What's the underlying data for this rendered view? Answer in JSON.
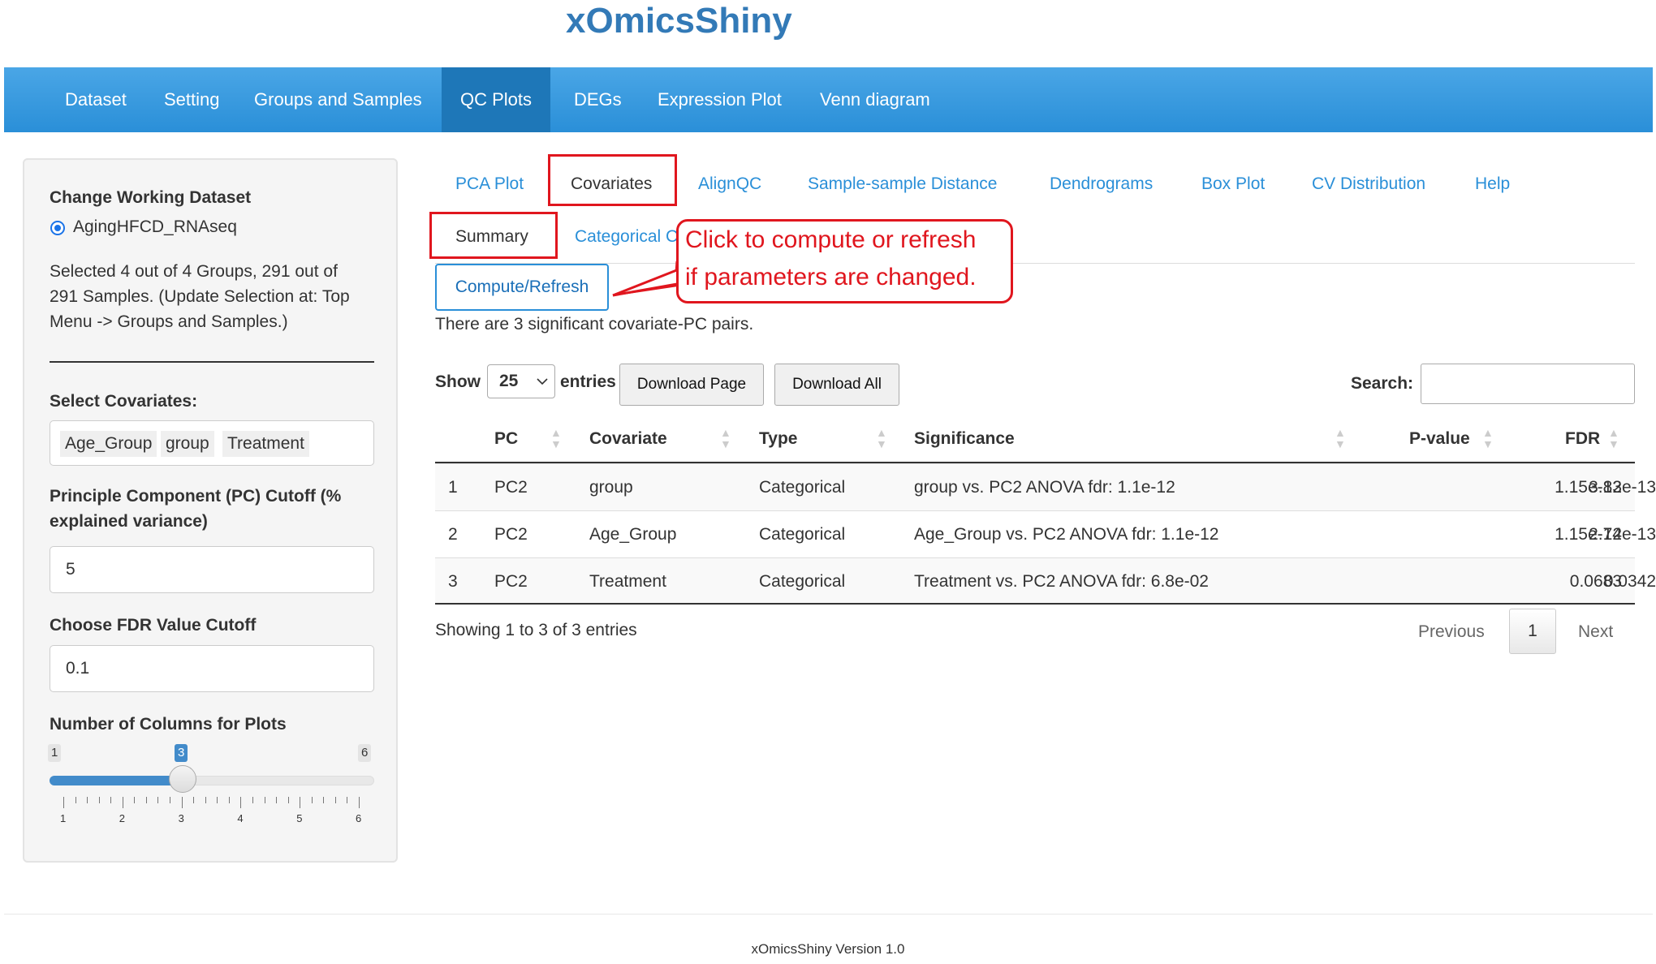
{
  "app": {
    "title": "xOmicsShiny"
  },
  "navbar": {
    "items": [
      {
        "label": "Dataset"
      },
      {
        "label": "Setting"
      },
      {
        "label": "Groups and Samples"
      },
      {
        "label": "QC Plots",
        "active": true
      },
      {
        "label": "DEGs"
      },
      {
        "label": "Expression Plot"
      },
      {
        "label": "Venn diagram"
      }
    ]
  },
  "sidebar": {
    "dataset_label": "Change Working Dataset",
    "dataset_option": "AgingHFCD_RNAseq",
    "selection_line1": "Selected 4 out of 4 Groups, 291 out of",
    "selection_line2": "291 Samples. (Update Selection at: Top",
    "selection_line3": "Menu -> Groups and Samples.)",
    "covariates_label": "Select Covariates:",
    "covariates": [
      "Age_Group",
      "group",
      "Treatment"
    ],
    "pc_cutoff_label_line1": "Principle Component (PC) Cutoff (%",
    "pc_cutoff_label_line2": "explained variance)",
    "pc_cutoff_value": "5",
    "fdr_label": "Choose FDR Value Cutoff",
    "fdr_value": "0.1",
    "columns_label": "Number of Columns for Plots",
    "slider": {
      "min": "1",
      "max": "6",
      "value": "3",
      "ticks": [
        "1",
        "2",
        "3",
        "4",
        "5",
        "6"
      ]
    }
  },
  "tabs": {
    "main": [
      {
        "label": "PCA Plot"
      },
      {
        "label": "Covariates",
        "active": true
      },
      {
        "label": "AlignQC"
      },
      {
        "label": "Sample-sample Distance"
      },
      {
        "label": "Dendrograms"
      },
      {
        "label": "Box Plot"
      },
      {
        "label": "CV Distribution"
      },
      {
        "label": "Help"
      }
    ],
    "sub": [
      {
        "label": "Summary",
        "active": true
      },
      {
        "label": "Categorical C"
      }
    ]
  },
  "compute_button": "Compute/Refresh",
  "callout": {
    "line1": "Click to compute or refresh",
    "line2": "if parameters are changed."
  },
  "summary_text": "There are 3 significant covariate-PC pairs.",
  "table_controls": {
    "show_label": "Show",
    "page_length": "25",
    "entries_label": "entries",
    "download_page": "Download Page",
    "download_all": "Download All",
    "search_label": "Search:"
  },
  "table": {
    "columns": [
      "",
      "PC",
      "Covariate",
      "Type",
      "Significance",
      "P-value",
      "FDR"
    ],
    "rows": [
      [
        "1",
        "PC2",
        "group",
        "Categorical",
        "group vs. PC2 ANOVA fdr: 1.1e-12",
        "3.83e-13",
        "1.15e-12"
      ],
      [
        "2",
        "PC2",
        "Age_Group",
        "Categorical",
        "Age_Group vs. PC2 ANOVA fdr: 1.1e-12",
        "2.74e-13",
        "1.15e-12"
      ],
      [
        "3",
        "PC2",
        "Treatment",
        "Categorical",
        "Treatment vs. PC2 ANOVA fdr: 6.8e-02",
        "0.0342",
        "0.0683"
      ]
    ],
    "info": "Showing 1 to 3 of 3 entries",
    "pagination": {
      "previous": "Previous",
      "current": "1",
      "next": "Next"
    }
  },
  "footer": "xOmicsShiny Version 1.0",
  "colors": {
    "navbar": "#2a8fd8",
    "navbar_active": "#1e77b8",
    "link": "#2a8fd8",
    "highlight": "#e0161e",
    "slider": "#428bca"
  }
}
